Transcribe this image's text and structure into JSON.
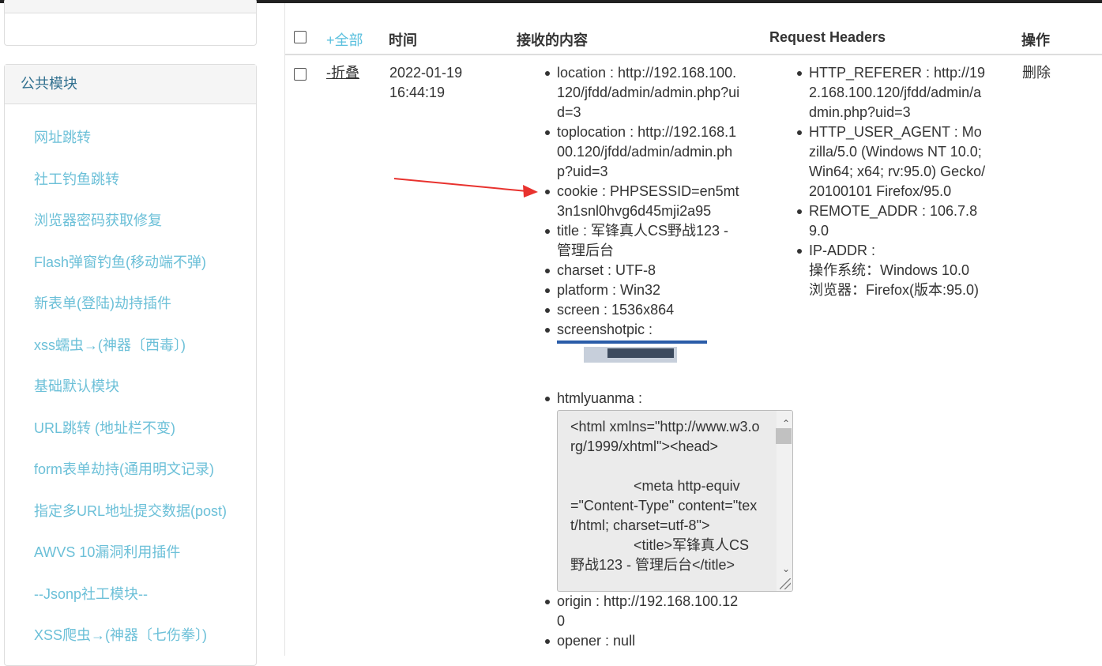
{
  "sidebar": {
    "panel_title": "公共模块",
    "items": [
      "网址跳转",
      "社工钓鱼跳转",
      "浏览器密码获取修复",
      "Flash弹窗钓鱼(移动端不弹)",
      "新表单(登陆)劫持插件",
      "xss蠕虫→(神器〔西毒〕)",
      "基础默认模块",
      "URL跳转 (地址栏不变)",
      "form表单劫持(通用明文记录)",
      "指定多URL地址提交数据(post)",
      "AWVS 10漏洞利用插件",
      "--Jsonp社工模块--",
      "XSS爬虫→(神器〔七伤拳〕)"
    ]
  },
  "table": {
    "headers": {
      "all": "+全部",
      "time": "时间",
      "content": "接收的内容",
      "headers": "Request Headers",
      "action": "操作"
    },
    "row": {
      "toggle": "-折叠",
      "date": "2022-01-19",
      "time": "16:44:19",
      "content": {
        "location": "location : http://192.168.100.120/jfdd/admin/admin.php?uid=3",
        "toplocation": "toplocation : http://192.168.100.120/jfdd/admin/admin.php?uid=3",
        "cookie": "cookie : PHPSESSID=en5mt3n1snl0hvg6d45mji2a95",
        "title": "title : 军锋真人CS野战123 - 管理后台",
        "charset": "charset : UTF-8",
        "platform": "platform : Win32",
        "screen": "screen : 1536x864",
        "screenshotpic": "screenshotpic :",
        "htmlyuanma": "htmlyuanma :",
        "htmlyuanma_text": "<html xmlns=\"http://www.w3.org/1999/xhtml\"><head>\n\n\t\t<meta http-equiv=\"Content-Type\" content=\"text/html; charset=utf-8\">\n\t\t<title>军锋真人CS野战123 - 管理后台</title>",
        "origin": "origin : http://192.168.100.120",
        "opener": "opener : null"
      },
      "request_headers": {
        "referer": "HTTP_REFERER : http://192.168.100.120/jfdd/admin/admin.php?uid=3",
        "user_agent": "HTTP_USER_AGENT : Mozilla/5.0 (Windows NT 10.0; Win64; x64; rv:95.0) Gecko/20100101 Firefox/95.0",
        "remote_addr": "REMOTE_ADDR : 106.7.89.0",
        "ip_addr": "IP-ADDR :",
        "os": "操作系统：Windows 10.0",
        "browser": "浏览器：Firefox(版本:95.0)"
      },
      "delete": "删除"
    }
  },
  "colors": {
    "link": "#5bc0de",
    "sidebar_link": "#6cc0d8",
    "panel_title": "#31708f",
    "arrow": "#e8322e"
  }
}
